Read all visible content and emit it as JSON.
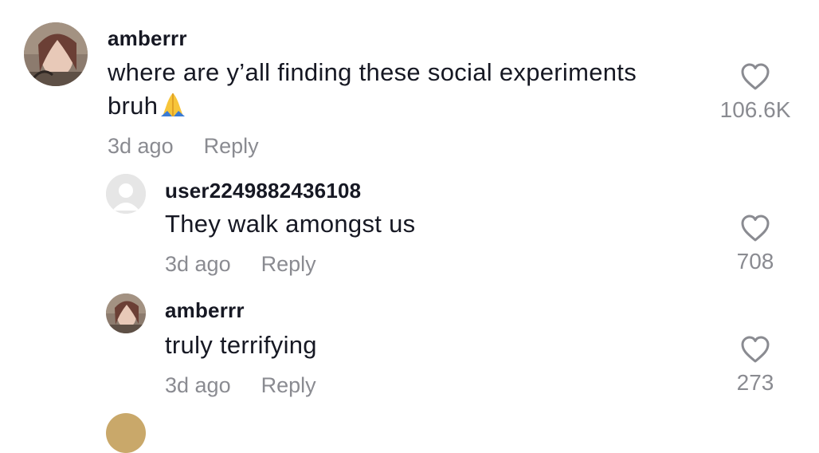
{
  "comments": [
    {
      "username": "amberrr",
      "text": "where are y’all finding these social experiments bruh",
      "emoji": "folded-hands-emoji",
      "time": "3d ago",
      "reply_label": "Reply",
      "likes": "106.6K",
      "avatar": "profile-photo"
    },
    {
      "username": "user2249882436108",
      "text": "They walk amongst us",
      "time": "3d ago",
      "reply_label": "Reply",
      "likes": "708",
      "avatar": "default-avatar"
    },
    {
      "username": "amberrr",
      "text": "truly terrifying",
      "time": "3d ago",
      "reply_label": "Reply",
      "likes": "273",
      "avatar": "profile-photo"
    }
  ],
  "colors": {
    "primary_text": "#161823",
    "secondary_text": "#8a8b91",
    "heart_outline": "#8a8b91",
    "background": "#ffffff"
  }
}
